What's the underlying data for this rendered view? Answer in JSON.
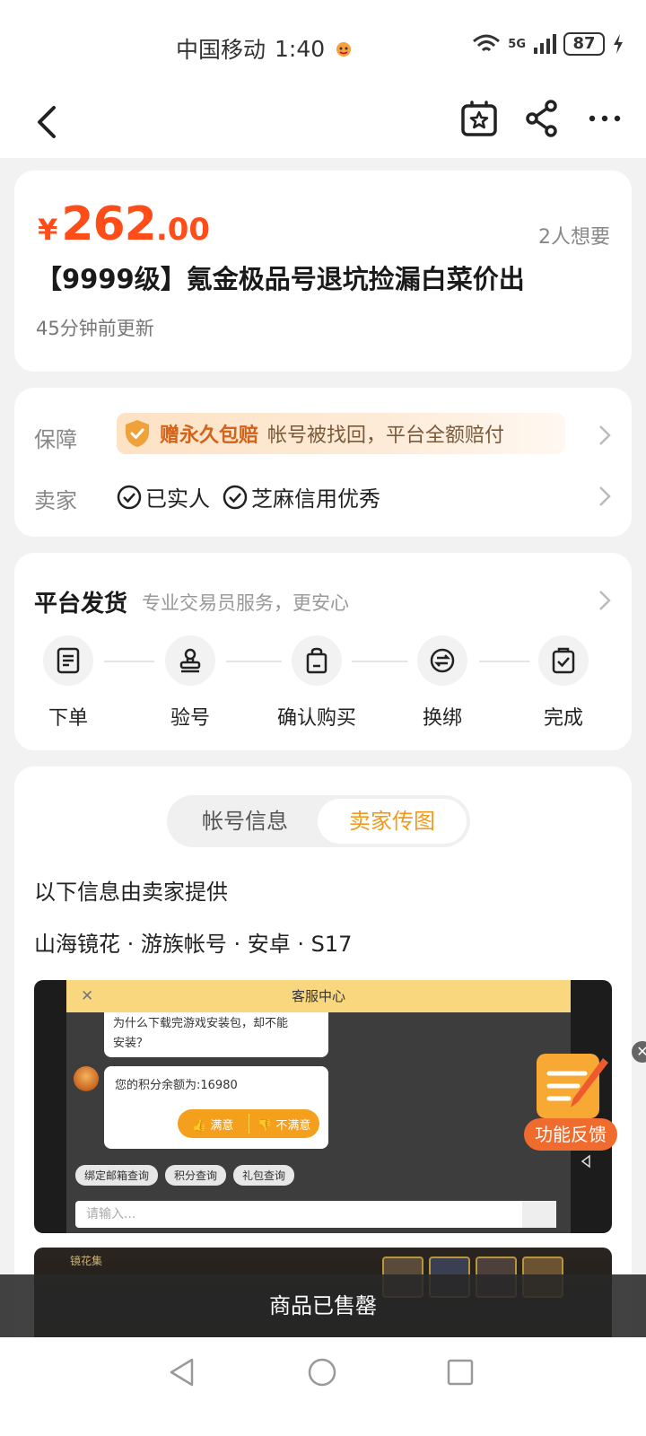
{
  "status_bar": {
    "carrier": "中国移动",
    "time": "1:40",
    "network": "5G",
    "battery": "87"
  },
  "nav": {
    "back_icon": "chevron-left-icon",
    "favorite_icon": "star-box-icon",
    "share_icon": "share-icon",
    "more_icon": "more-dots-icon"
  },
  "product": {
    "currency": "¥",
    "price_int": "262",
    "price_dec": ".00",
    "wants": "2人想要",
    "title": "【9999级】氪金极品号退坑捡漏白菜价出",
    "updated": "45分钟前更新"
  },
  "guarantee": {
    "label": "保障",
    "badge": "赠永久包赔",
    "text": "帐号被找回，平台全额赔付",
    "seller_label": "卖家",
    "seller_tags": [
      "已实人",
      "芝麻信用优秀"
    ]
  },
  "shipping": {
    "title": "平台发货",
    "subtitle": "专业交易员服务，更安心",
    "steps": [
      "下单",
      "验号",
      "确认购买",
      "换绑",
      "完成"
    ]
  },
  "info": {
    "tabs": [
      "帐号信息",
      "卖家传图"
    ],
    "active_tab": "卖家传图",
    "provided_by": "以下信息由卖家提供",
    "attributes": "山海镜花 · 游族帐号 · 安卓 · S17"
  },
  "screenshot1": {
    "header": "客服中心",
    "question_line1": "为什么下载完游戏安装包，却不能",
    "question_line2": "安装？",
    "balance": "您的积分余额为:16980",
    "satisfied": "满意",
    "unsatisfied": "不满意",
    "quick_links": [
      "绑定邮箱查询",
      "积分查询",
      "礼包查询"
    ],
    "input_placeholder": "请输入..."
  },
  "screenshot2": {
    "label": "镜花集"
  },
  "feedback": {
    "label": "功能反馈"
  },
  "sold": {
    "text": "商品已售罄"
  },
  "colors": {
    "price": "#ff4d1a",
    "accent": "#f39a1e",
    "guarantee_text": "#d4631a"
  }
}
